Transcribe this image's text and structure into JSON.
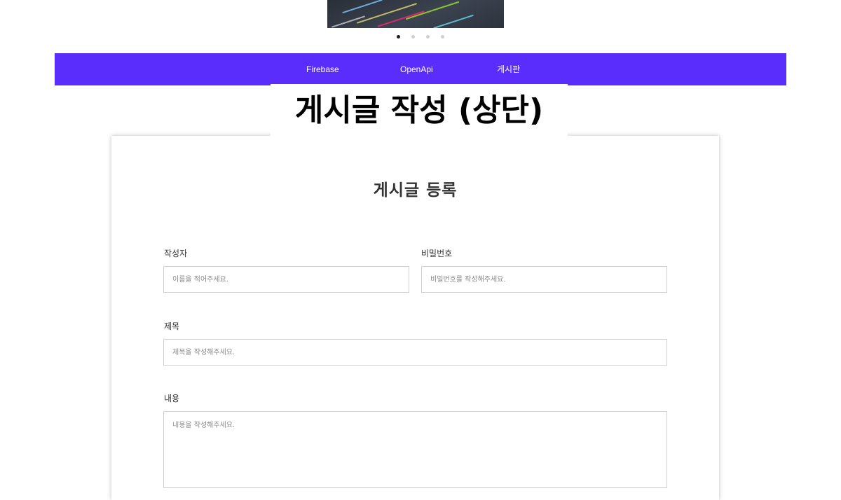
{
  "carousel": {
    "slide_count": 4,
    "active_index": 0
  },
  "nav": {
    "items": [
      {
        "label": "Firebase"
      },
      {
        "label": "OpenApi"
      },
      {
        "label": "게시판"
      }
    ]
  },
  "caption": "게시글 작성 (상단)",
  "form": {
    "title": "게시글 등록",
    "author": {
      "label": "작성자",
      "placeholder": "이름을 적어주세요."
    },
    "password": {
      "label": "비밀번호",
      "placeholder": "비밀번호를 작성해주세요."
    },
    "subject": {
      "label": "제목",
      "placeholder": "제목을 작성해주세요."
    },
    "content": {
      "label": "내용",
      "placeholder": "내용을 작성해주세요."
    }
  },
  "colors": {
    "nav_background": "#5a2dfd",
    "nav_text": "#ffffff",
    "field_border": "#cfcfcf"
  }
}
